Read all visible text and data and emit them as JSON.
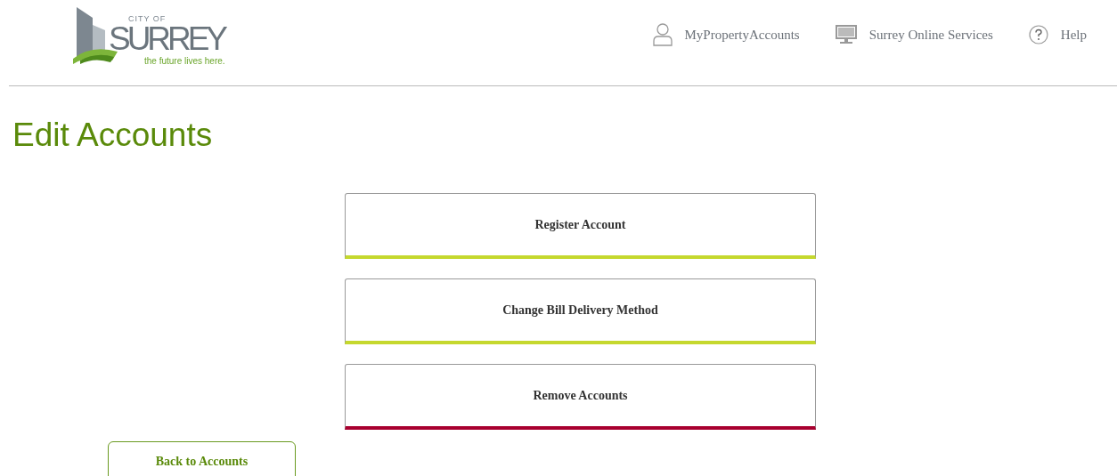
{
  "logo": {
    "small": "CITY OF",
    "name": "SURREY",
    "tagline": "the future lives here."
  },
  "nav": [
    {
      "kind": "user",
      "label": "MyPropertyAccounts"
    },
    {
      "kind": "monitor",
      "label": "Surrey Online Services"
    },
    {
      "kind": "help",
      "label": "Help"
    }
  ],
  "title": "Edit Accounts",
  "actions": [
    {
      "label": "Register Account",
      "color": "#c5d82e"
    },
    {
      "label": "Change Bill Delivery Method",
      "color": "#c5d82e"
    },
    {
      "label": "Remove Accounts",
      "color": "#a8002f"
    }
  ],
  "back_button": "Back to Accounts"
}
